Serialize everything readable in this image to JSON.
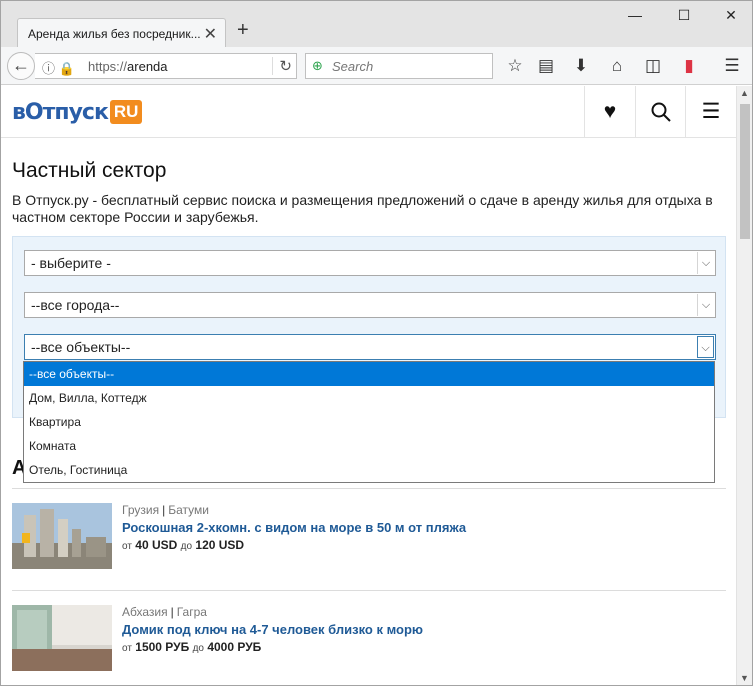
{
  "browser": {
    "tab_title": "Аренда жилья без посредник...",
    "tab_close": "✕",
    "new_tab": "+",
    "window_controls": {
      "minimize": "—",
      "maximize": "☐",
      "close": "✕"
    },
    "url_protocol": "https://",
    "url_path": "arenda",
    "search_placeholder": "Search"
  },
  "site": {
    "logo_text": "вОтпуск",
    "logo_badge": "RU"
  },
  "page": {
    "title": "Частный сектор",
    "intro": "В Отпуск.ру - бесплатный сервис поиска и размещения предложений о сдаче в аренду жилья для отдыха в частном секторе России и зарубежья."
  },
  "filters": {
    "country": "- выберите -",
    "city": "--все города--",
    "object_type": "--все объекты--",
    "object_options": [
      "--все объекты--",
      "Дом, Вилла, Коттедж",
      "Квартира",
      "Комната",
      "Отель, Гостиница"
    ]
  },
  "section_heading": "А",
  "listings": [
    {
      "country": "Грузия",
      "city": "Батуми",
      "title": "Роскошная 2-хкомн. с видом на море в 50 м от пляжа",
      "price_from_label": "от",
      "price_from": "40 USD",
      "price_to_label": "до",
      "price_to": "120 USD"
    },
    {
      "country": "Абхазия",
      "city": "Гагра",
      "title": "Домик под ключ на 4-7 человек близко к морю",
      "price_from_label": "от",
      "price_from": "1500 РУБ",
      "price_to_label": "до",
      "price_to": "4000 РУБ"
    }
  ],
  "colors": {
    "logo_blue": "#2a5ea8",
    "logo_orange": "#f28c1e",
    "link_blue": "#1f5a96",
    "selected_option": "#0078d7",
    "filter_bg": "#eaf3fb"
  }
}
